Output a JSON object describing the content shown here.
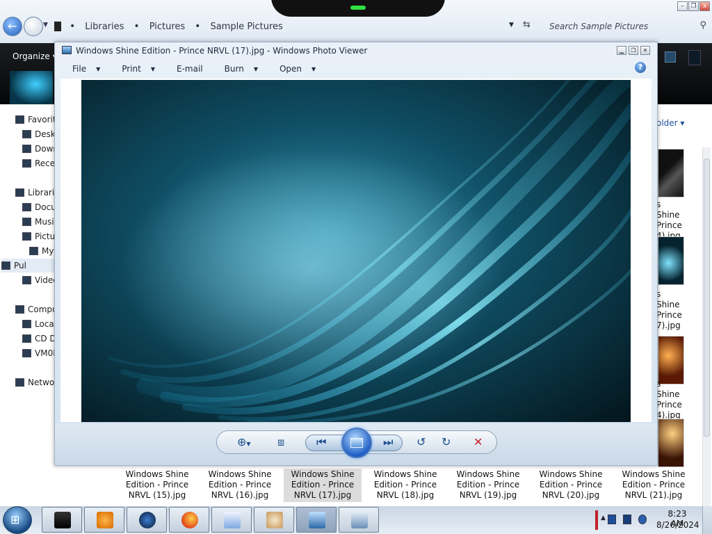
{
  "explorer": {
    "breadcrumb": [
      "Libraries",
      "Pictures",
      "Sample Pictures"
    ],
    "search_placeholder": "Search Sample Pictures",
    "organize_label": "Organize",
    "sort_label": "older",
    "nav_pane": [
      {
        "label": "Favorit",
        "icon": "star-icon"
      },
      {
        "label": "Desk",
        "icon": "desktop-icon"
      },
      {
        "label": "Dowr",
        "icon": "downloads-icon"
      },
      {
        "label": "Rece",
        "icon": "recent-places-icon"
      },
      {
        "label": "Librari",
        "icon": "library-icon"
      },
      {
        "label": "Docu",
        "icon": "documents-icon"
      },
      {
        "label": "Musi",
        "icon": "music-icon"
      },
      {
        "label": "Pictu",
        "icon": "pictures-icon"
      },
      {
        "label": "My",
        "icon": "folder-icon"
      },
      {
        "label": "Pul",
        "icon": "folder-icon"
      },
      {
        "label": "Videc",
        "icon": "videos-icon"
      },
      {
        "label": "Compu",
        "icon": "computer-icon"
      },
      {
        "label": "Loca",
        "icon": "drive-icon"
      },
      {
        "label": "CD D",
        "icon": "cd-drive-icon"
      },
      {
        "label": "VM0I",
        "icon": "network-drive-icon"
      },
      {
        "label": "Netwo",
        "icon": "network-icon"
      }
    ],
    "right_partial_items": [
      {
        "line1": "s Shine",
        "line2": "Prince",
        "line3": "4).jpg"
      },
      {
        "line1": "s Shine",
        "line2": "Prince",
        "line3": "7).jpg"
      },
      {
        "line1": "s Shine",
        "line2": "Prince",
        "line3": "4).jpg"
      }
    ],
    "files": [
      {
        "line1": "Windows Shine",
        "line2": "Edition - Prince",
        "line3": "NRVL (15).jpg"
      },
      {
        "line1": "Windows Shine",
        "line2": "Edition - Prince",
        "line3": "NRVL (16).jpg"
      },
      {
        "line1": "Windows Shine",
        "line2": "Edition - Prince",
        "line3": "NRVL (17).jpg",
        "selected": true
      },
      {
        "line1": "Windows Shine",
        "line2": "Edition - Prince",
        "line3": "NRVL (18).jpg"
      },
      {
        "line1": "Windows Shine",
        "line2": "Edition - Prince",
        "line3": "NRVL (19).jpg"
      },
      {
        "line1": "Windows Shine",
        "line2": "Edition - Prince",
        "line3": "NRVL (20).jpg"
      },
      {
        "line1": "Windows Shine",
        "line2": "Edition - Prince",
        "line3": "NRVL (21).jpg"
      }
    ]
  },
  "viewer": {
    "title": "Windows Shine Edition - Prince NRVL (17).jpg - Windows Photo Viewer",
    "menu": [
      "File",
      "Print",
      "E-mail",
      "Burn",
      "Open"
    ],
    "menu_has_dropdown": [
      true,
      true,
      false,
      true,
      true
    ],
    "controls": [
      {
        "name": "zoom-icon",
        "glyph": "⊕"
      },
      {
        "name": "actual-size-icon",
        "glyph": "⧈"
      },
      {
        "name": "previous-icon",
        "glyph": "⏮"
      },
      {
        "name": "slideshow-icon",
        "glyph": ""
      },
      {
        "name": "next-icon",
        "glyph": "⏭"
      },
      {
        "name": "rotate-left-icon",
        "glyph": "↺"
      },
      {
        "name": "rotate-right-icon",
        "glyph": "↻"
      },
      {
        "name": "delete-icon",
        "glyph": "✕"
      }
    ],
    "colors": {
      "photo_dark": "#06242f",
      "photo_glow": "#7fe3ff",
      "accent": "#1f5fc6",
      "delete": "#c3202a"
    }
  },
  "taskbar": {
    "apps": [
      "explorer-icon",
      "media-player-icon",
      "blue-orb-icon",
      "firefox-icon",
      "checklist-icon",
      "paint-icon",
      "photo-viewer-icon",
      "network-setup-icon"
    ],
    "active_index": 6,
    "time": "8:23 AM",
    "date": "8/26/2024"
  }
}
